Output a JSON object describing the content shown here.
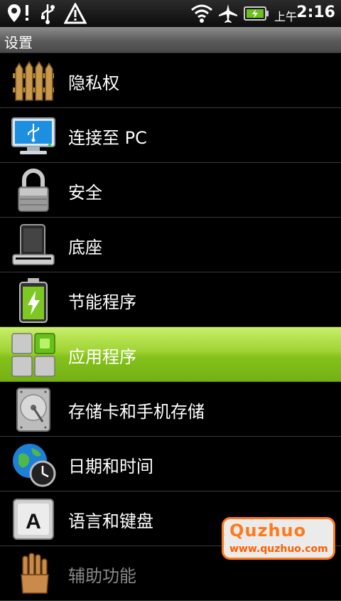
{
  "status_bar": {
    "icons": [
      "location-alert-icon",
      "usb-icon",
      "warning-icon",
      "wifi-icon",
      "airplane-icon",
      "battery-charging-icon"
    ],
    "ampm": "上午",
    "time": "2:16"
  },
  "title_bar": {
    "title": "设置"
  },
  "settings": {
    "items": [
      {
        "label": "隐私权",
        "icon": "fence-icon"
      },
      {
        "label": "连接至 PC",
        "icon": "monitor-usb-icon"
      },
      {
        "label": "安全",
        "icon": "padlock-icon"
      },
      {
        "label": "底座",
        "icon": "dock-icon"
      },
      {
        "label": "节能程序",
        "icon": "battery-saver-icon"
      },
      {
        "label": "应用程序",
        "icon": "applications-grid-icon",
        "selected": true
      },
      {
        "label": "存储卡和手机存储",
        "icon": "hard-drive-icon"
      },
      {
        "label": "日期和时间",
        "icon": "globe-clock-icon"
      },
      {
        "label": "语言和键盘",
        "icon": "keyboard-key-icon"
      },
      {
        "label": "辅助功能",
        "icon": "hand-icon"
      }
    ]
  },
  "watermark": {
    "brand": "Quzhuo",
    "url": "www.quzhuo.com"
  },
  "colors": {
    "selected_row": "#9fd233",
    "background": "#000000",
    "watermark": "#ff7a1a"
  }
}
